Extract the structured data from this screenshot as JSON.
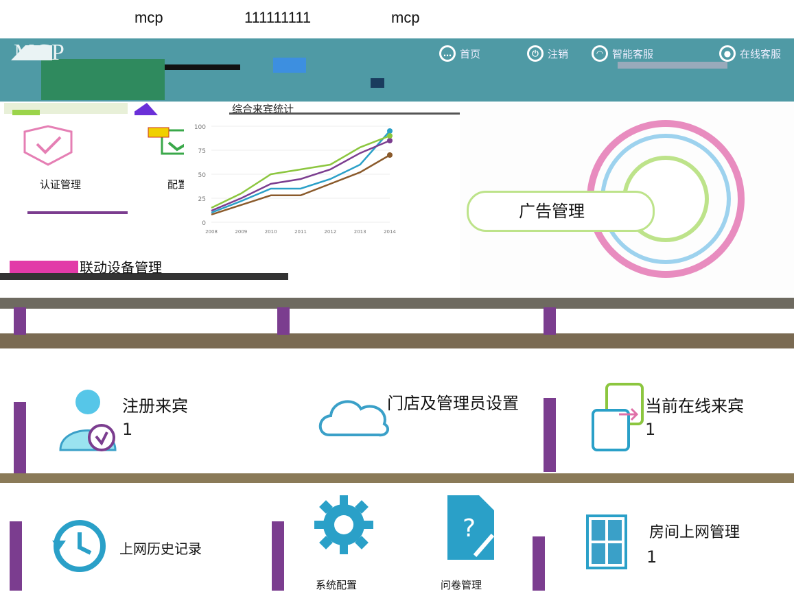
{
  "top": {
    "left_text": "mcp",
    "middle_text": "111111111",
    "right_text": "mcp"
  },
  "header": {
    "logo_text": "MCP",
    "nav": [
      {
        "icon": "chat-icon",
        "label": "首页"
      },
      {
        "icon": "power-icon",
        "label": "注销"
      },
      {
        "icon": "headset-icon",
        "label": "智能客服"
      },
      {
        "icon": "user-icon",
        "label": "在线客服"
      }
    ]
  },
  "row1": {
    "auth_label": "认证管理",
    "wizard_label": "配置向导",
    "chart_title": "综合来宾统计",
    "ad_label": "广告管理",
    "device_label": "联动设备管理"
  },
  "row2": {
    "registered_label": "注册来宾",
    "registered_count": "1",
    "admin_label": "门店及管理员设置",
    "online_label": "当前在线来宾",
    "online_count": "1"
  },
  "row3": {
    "history_label": "上网历史记录",
    "sysconfig_label": "系统配置",
    "survey_label": "问卷管理",
    "room_label": "房间上网管理",
    "room_count": "1"
  },
  "colors": {
    "header": "#4f9aa5",
    "accent_purple": "#7b3d8f",
    "accent_teal": "#2aa0c8",
    "accent_green": "#8cc63f",
    "accent_pink": "#e070a8"
  },
  "chart_data": {
    "type": "line",
    "title": "综合来宾统计",
    "x": [
      "2008",
      "2009",
      "2010",
      "2011",
      "2012",
      "2013",
      "2014"
    ],
    "yticks": [
      0,
      25,
      50,
      75,
      100
    ],
    "ylim": [
      0,
      100
    ],
    "series": [
      {
        "values": [
          10,
          22,
          35,
          35,
          45,
          60,
          95
        ],
        "color": "#2aa0c8"
      },
      {
        "values": [
          12,
          25,
          40,
          45,
          55,
          72,
          85
        ],
        "color": "#7b3d8f"
      },
      {
        "values": [
          8,
          18,
          28,
          28,
          40,
          52,
          70
        ],
        "color": "#8a5a2b"
      },
      {
        "values": [
          15,
          30,
          50,
          55,
          60,
          78,
          90
        ],
        "color": "#8cc63f"
      }
    ]
  }
}
